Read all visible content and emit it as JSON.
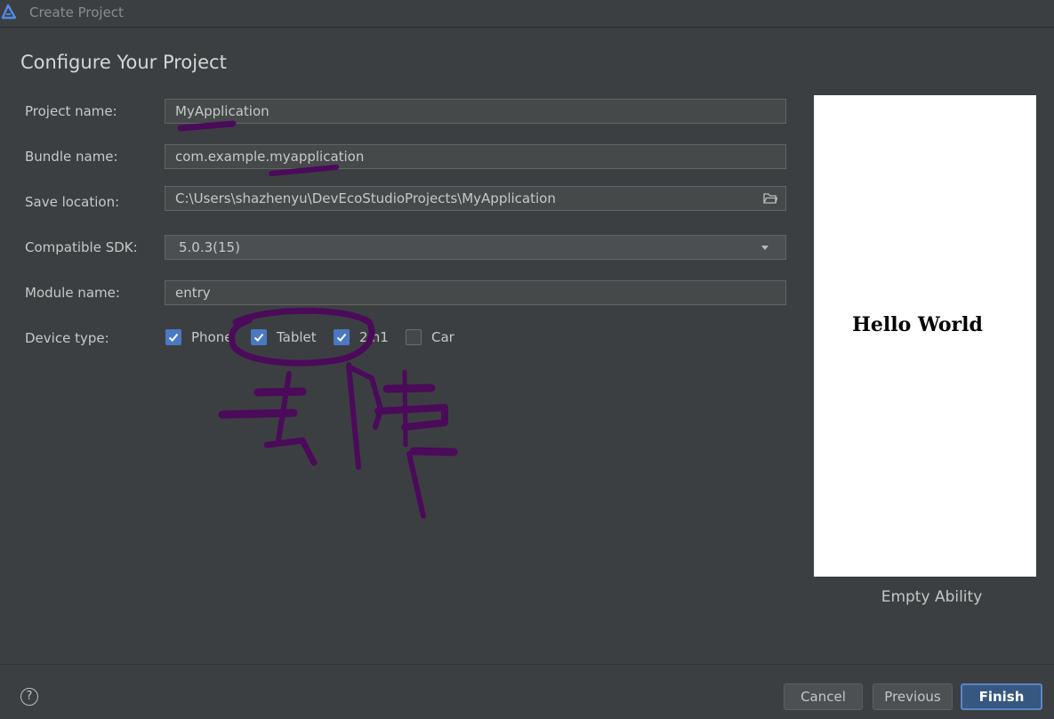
{
  "window": {
    "title": "Create Project",
    "logo_icon": "deveco-logo-icon"
  },
  "page_title": "Configure Your Project",
  "form": {
    "project_name": {
      "label": "Project name:",
      "value": "MyApplication"
    },
    "bundle_name": {
      "label": "Bundle name:",
      "value": "com.example.myapplication"
    },
    "save_location": {
      "label": "Save location:",
      "value": "C:\\Users\\shazhenyu\\DevEcoStudioProjects\\MyApplication",
      "icon": "folder-icon"
    },
    "compatible_sdk": {
      "label": "Compatible SDK:",
      "value": "5.0.3(15)",
      "icon": "chevron-down-icon"
    },
    "module_name": {
      "label": "Module name:",
      "value": "entry"
    },
    "device_type": {
      "label": "Device type:",
      "options": [
        {
          "label": "Phone",
          "checked": true
        },
        {
          "label": "Tablet",
          "checked": true
        },
        {
          "label": "2in1",
          "checked": true
        },
        {
          "label": "Car",
          "checked": false
        }
      ]
    }
  },
  "preview": {
    "text": "Hello World",
    "template_name": "Empty Ability"
  },
  "footer": {
    "help_label": "?",
    "cancel_label": "Cancel",
    "previous_label": "Previous",
    "finish_label": "Finish"
  },
  "colors": {
    "accent": "#4a78c2",
    "primary_button": "#365880",
    "annotation_ink": "#4b0a5a"
  }
}
